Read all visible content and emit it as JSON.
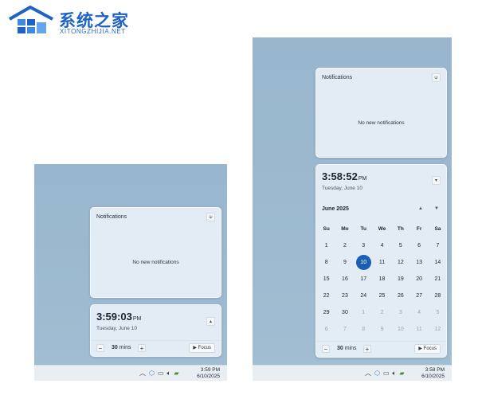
{
  "watermark": {
    "cn": "系统之家",
    "en": "XITONGZHIJIA.NET"
  },
  "left_panel": {
    "notifications": {
      "title": "Notifications",
      "empty": "No new notifications"
    },
    "clock": {
      "time": "3:59:03",
      "ampm": "PM",
      "date": "Tuesday, June 10"
    },
    "focus": {
      "minus": "−",
      "value": "30",
      "unit": "mins",
      "plus": "+",
      "button": "Focus"
    },
    "taskbar": {
      "time": "3:59 PM",
      "date": "6/10/2025"
    }
  },
  "right_panel": {
    "notifications": {
      "title": "Notifications",
      "empty": "No new notifications"
    },
    "clock": {
      "time": "3:58:52",
      "ampm": "PM",
      "date": "Tuesday, June 10"
    },
    "calendar": {
      "month": "June 2025",
      "weekdays": [
        "Su",
        "Mo",
        "Tu",
        "We",
        "Th",
        "Fr",
        "Sa"
      ],
      "days": [
        {
          "n": "1"
        },
        {
          "n": "2"
        },
        {
          "n": "3"
        },
        {
          "n": "4"
        },
        {
          "n": "5"
        },
        {
          "n": "6"
        },
        {
          "n": "7"
        },
        {
          "n": "8"
        },
        {
          "n": "9"
        },
        {
          "n": "10",
          "today": true
        },
        {
          "n": "11"
        },
        {
          "n": "12"
        },
        {
          "n": "13"
        },
        {
          "n": "14"
        },
        {
          "n": "15"
        },
        {
          "n": "16"
        },
        {
          "n": "17"
        },
        {
          "n": "18"
        },
        {
          "n": "19"
        },
        {
          "n": "20"
        },
        {
          "n": "21"
        },
        {
          "n": "22"
        },
        {
          "n": "23"
        },
        {
          "n": "24"
        },
        {
          "n": "25"
        },
        {
          "n": "26"
        },
        {
          "n": "27"
        },
        {
          "n": "28"
        },
        {
          "n": "29"
        },
        {
          "n": "30"
        },
        {
          "n": "1",
          "muted": true
        },
        {
          "n": "2",
          "muted": true
        },
        {
          "n": "3",
          "muted": true
        },
        {
          "n": "4",
          "muted": true
        },
        {
          "n": "5",
          "muted": true
        },
        {
          "n": "6",
          "muted": true
        },
        {
          "n": "7",
          "muted": true
        },
        {
          "n": "8",
          "muted": true
        },
        {
          "n": "9",
          "muted": true
        },
        {
          "n": "10",
          "muted": true
        },
        {
          "n": "11",
          "muted": true
        },
        {
          "n": "12",
          "muted": true
        }
      ]
    },
    "focus": {
      "minus": "−",
      "value": "30",
      "unit": "mins",
      "plus": "+",
      "button": "Focus"
    },
    "taskbar": {
      "time": "3:58 PM",
      "date": "6/10/2025"
    }
  },
  "icons": {
    "tray_chevron": "chevron-up-icon",
    "tray_cube": "cube-icon",
    "tray_monitor": "monitor-icon",
    "tray_volume": "volume-icon",
    "tray_battery": "battery-icon",
    "dnd": "notification-bell-icon",
    "calendar_collapse": "chevron-icon"
  },
  "colors": {
    "accent": "#1a5fb4",
    "desktop": "#9bb8ce",
    "card": "#e8f0f7"
  }
}
